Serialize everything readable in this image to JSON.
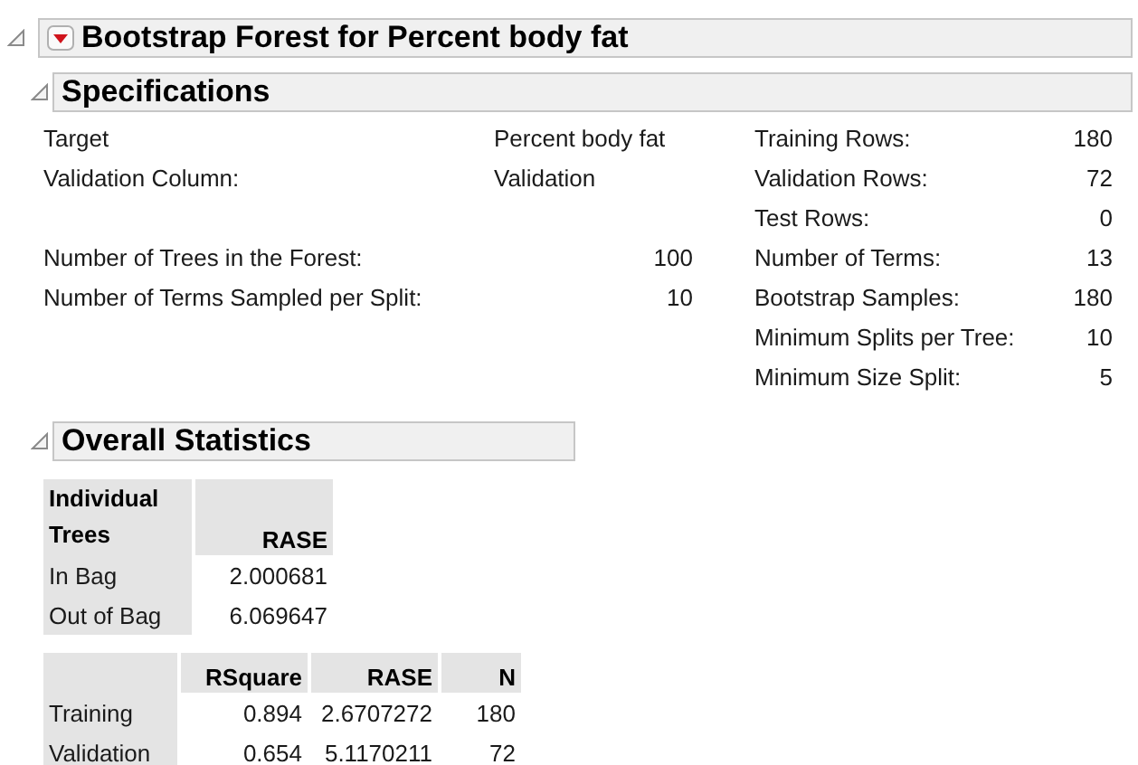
{
  "report": {
    "title": "Bootstrap Forest for Percent body fat",
    "expanded": true,
    "sections": [
      {
        "kind": "specs",
        "title": "Specifications",
        "expanded": true,
        "fields": [
          {
            "label": "Target",
            "value": "Percent body fat"
          },
          {
            "label": "Validation Column:",
            "value": "Validation"
          }
        ],
        "counts": [
          {
            "label": "Number of Trees in the Forest:",
            "value": "100"
          },
          {
            "label": "Number of Terms Sampled per Split:",
            "value": "10"
          }
        ],
        "settings": [
          {
            "label": "Training Rows:",
            "value": "180"
          },
          {
            "label": "Validation Rows:",
            "value": "72"
          },
          {
            "label": "Test Rows:",
            "value": "0"
          },
          {
            "label": "Number of Terms:",
            "value": "13"
          },
          {
            "label": "Bootstrap Samples:",
            "value": "180"
          },
          {
            "label": "Minimum Splits per Tree:",
            "value": "10"
          },
          {
            "label": "Minimum Size Split:",
            "value": "5"
          }
        ]
      },
      {
        "kind": "stats",
        "title": "Overall Statistics",
        "expanded": true,
        "tables": [
          {
            "columns": [
              "Individual Trees",
              "RASE"
            ],
            "rows": [
              [
                "In Bag",
                "2.000681"
              ],
              [
                "Out of Bag",
                "6.069647"
              ]
            ]
          },
          {
            "columns": [
              "",
              "RSquare",
              "RASE",
              "N"
            ],
            "rows": [
              [
                "Training",
                "0.894",
                "2.6707272",
                "180"
              ],
              [
                "Validation",
                "0.654",
                "5.1170211",
                "72"
              ]
            ]
          }
        ]
      }
    ]
  }
}
